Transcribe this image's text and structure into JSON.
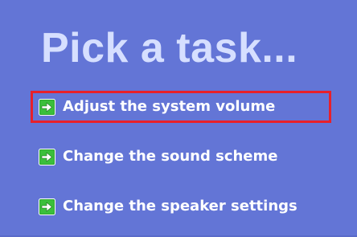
{
  "panel": {
    "title": "Pick a task...",
    "tasks": [
      {
        "label": "Adjust the system volume",
        "icon": "green-arrow-icon",
        "highlighted": true
      },
      {
        "label": "Change the sound scheme",
        "icon": "green-arrow-icon",
        "highlighted": false
      },
      {
        "label": "Change the speaker settings",
        "icon": "green-arrow-icon",
        "highlighted": false
      }
    ]
  },
  "colors": {
    "panel_background": "#6375d6",
    "title_text": "#d6dfff",
    "task_text": "#ffffff",
    "highlight_border": "#e8202a",
    "arrow_green": "#2fa52f"
  }
}
